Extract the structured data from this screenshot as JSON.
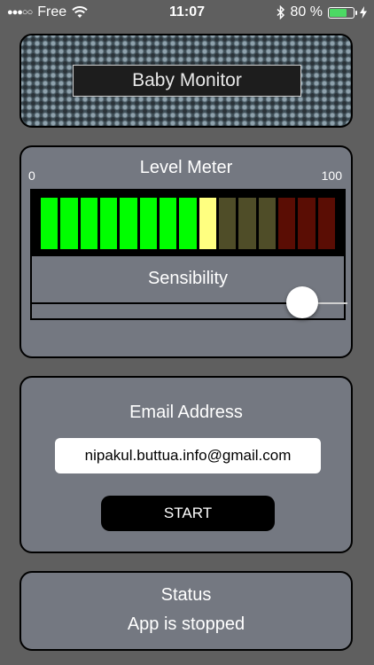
{
  "status_bar": {
    "signal_dots": "●●●○○",
    "carrier": "Free",
    "wifi_icon": "wifi-icon",
    "time": "11:07",
    "bluetooth_icon": "bluetooth-icon",
    "battery_percent": "80 %",
    "battery_level": 0.8,
    "charging_icon": "bolt-icon"
  },
  "header": {
    "title": "Baby Monitor"
  },
  "level_meter": {
    "title": "Level Meter",
    "scale_min": "0",
    "scale_max": "100",
    "bars": [
      {
        "color": "#00ff00"
      },
      {
        "color": "#00ff00"
      },
      {
        "color": "#00ff00"
      },
      {
        "color": "#00ff00"
      },
      {
        "color": "#00ff00"
      },
      {
        "color": "#00ff00"
      },
      {
        "color": "#00ff00"
      },
      {
        "color": "#00ff00"
      },
      {
        "color": "#ffff80"
      },
      {
        "color": "#4f4d28"
      },
      {
        "color": "#4f4d28"
      },
      {
        "color": "#4f4d28"
      },
      {
        "color": "#5a0d04"
      },
      {
        "color": "#5a0d04"
      },
      {
        "color": "#5a0d04"
      }
    ],
    "sensibility_label": "Sensibility",
    "sensibility_value": 0.86
  },
  "email": {
    "title": "Email Address",
    "value": "nipakul.buttua.info@gmail.com",
    "start_label": "START"
  },
  "status": {
    "title": "Status",
    "text": "App is stopped"
  }
}
